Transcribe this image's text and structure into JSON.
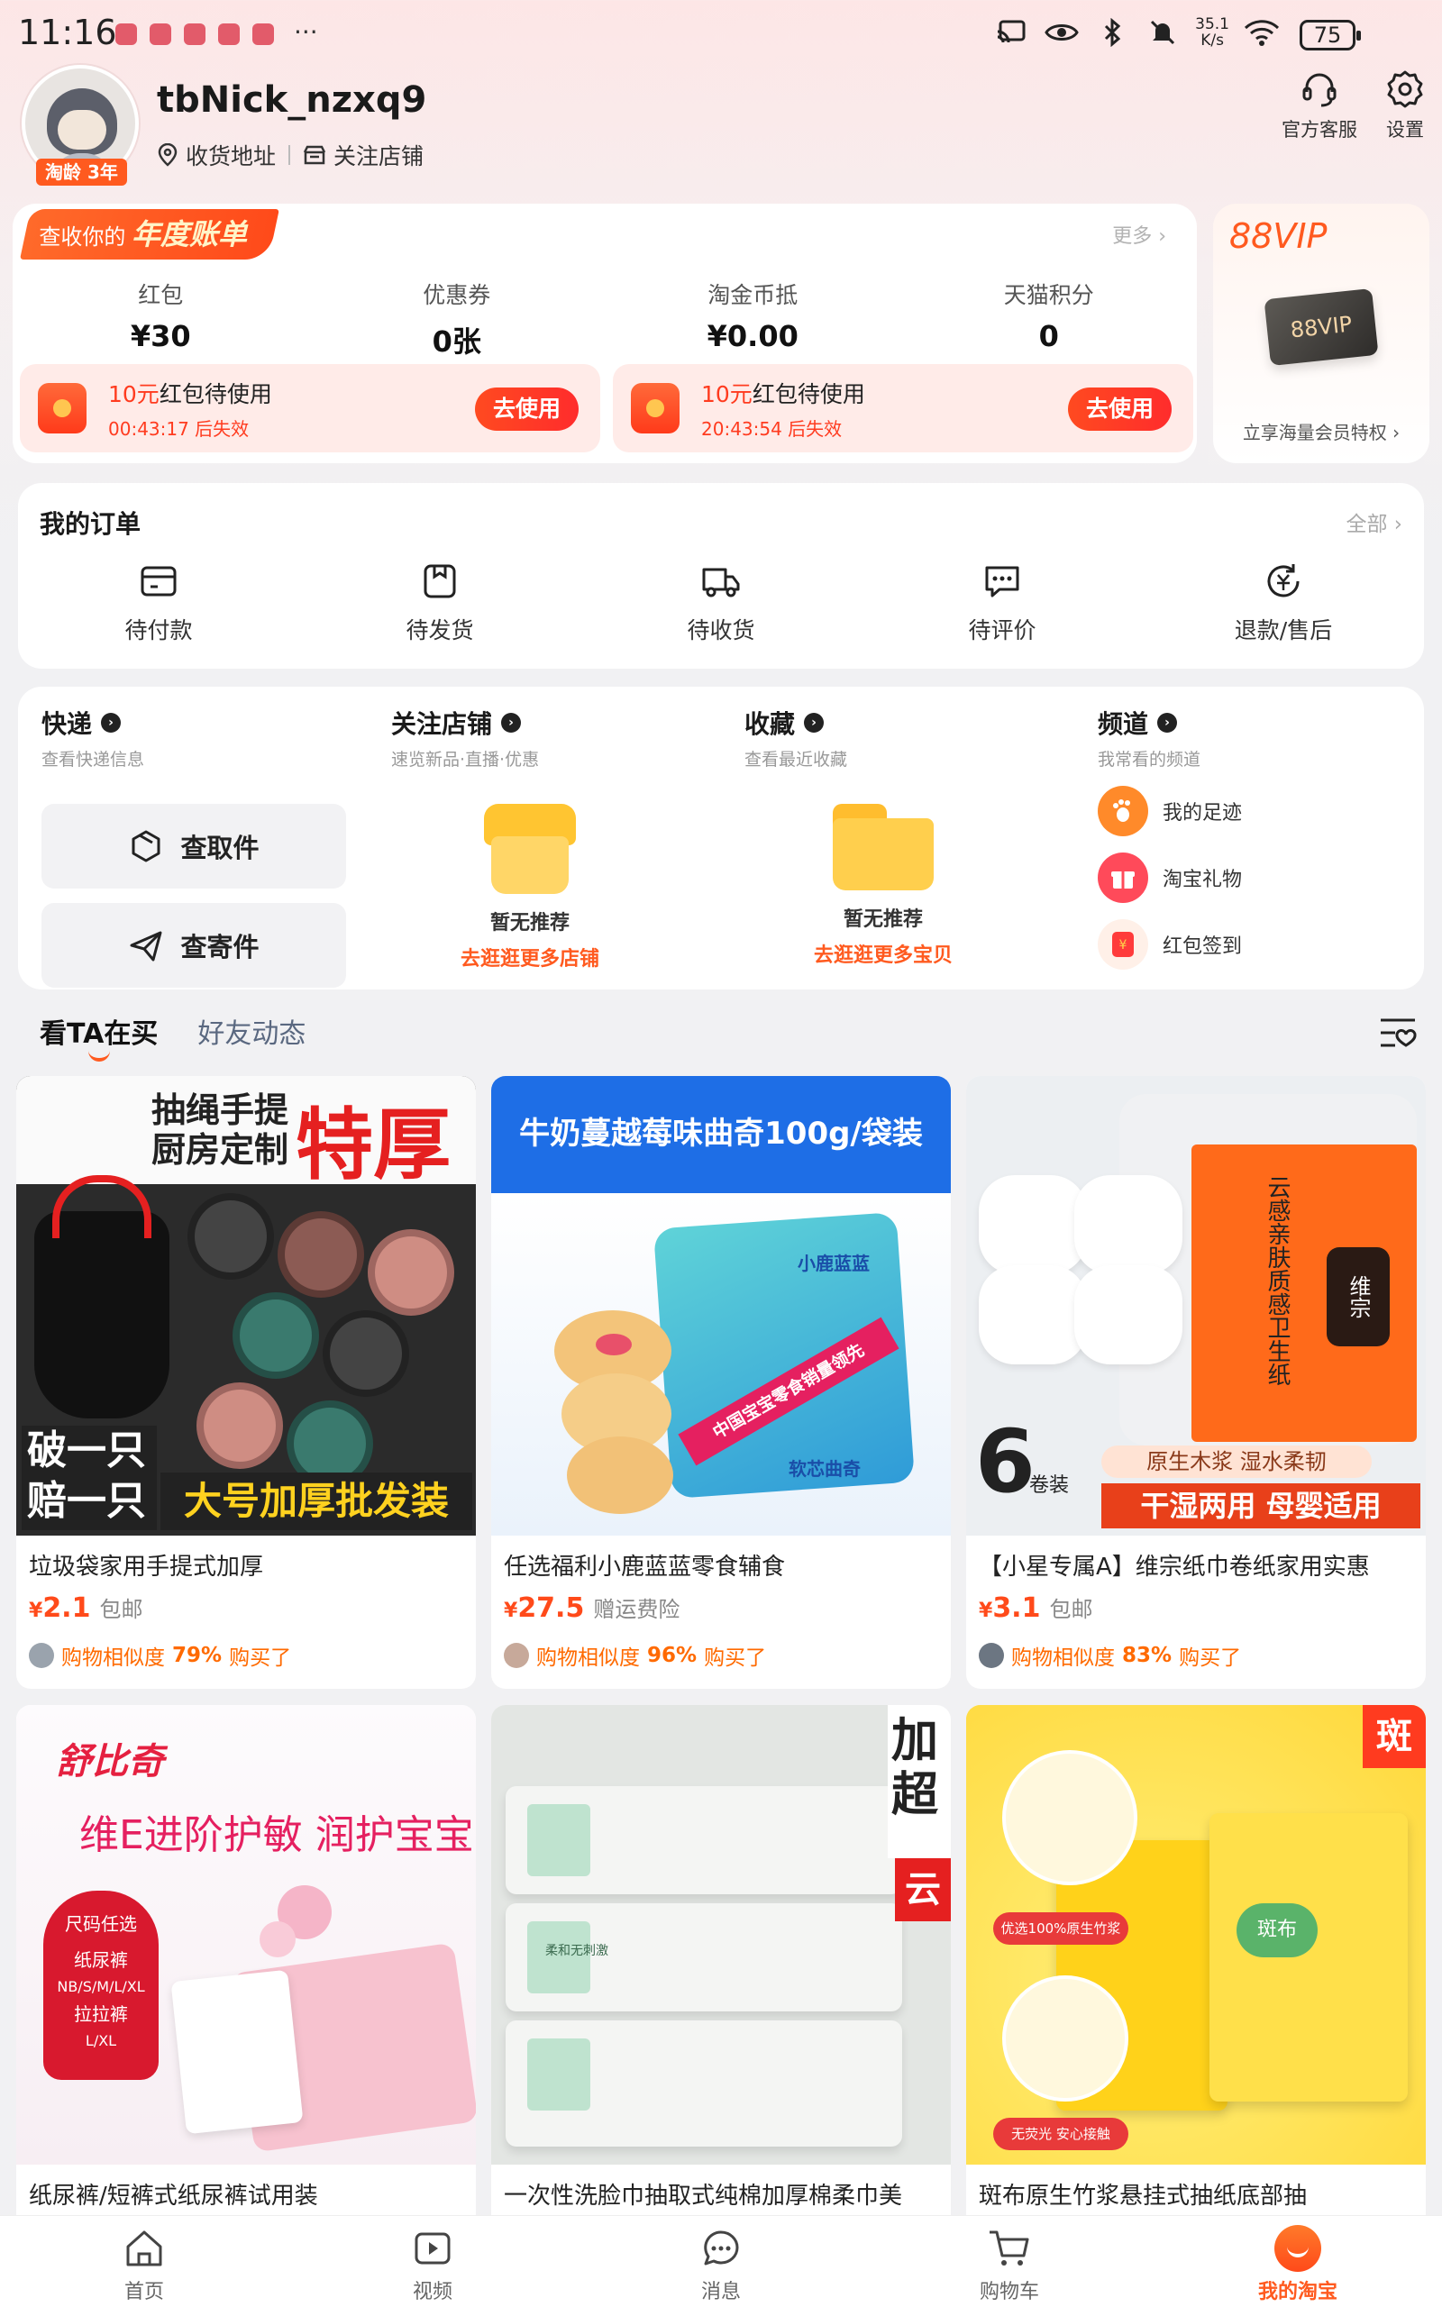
{
  "status_bar": {
    "time": "11:16",
    "more": "···",
    "net_speed": "35.1",
    "net_unit": "K/s",
    "battery": "75"
  },
  "profile": {
    "username": "tbNick_nzxq9",
    "age_badge": "淘龄 3年",
    "address_link": "收货地址",
    "followed_stores_link": "关注店铺",
    "service_label": "官方客服",
    "settings_label": "设置"
  },
  "assets": {
    "bill_prefix": "查收你的",
    "bill_title": "年度账单",
    "more": "更多 ›",
    "items": [
      {
        "label": "红包",
        "value": "¥30"
      },
      {
        "label": "优惠券",
        "value": "0张"
      },
      {
        "label": "淘金币抵",
        "value": "¥0.00"
      },
      {
        "label": "天猫积分",
        "value": "0"
      }
    ],
    "coupons": [
      {
        "amount": "10元",
        "text": "红包待使用",
        "countdown": "00:43:17 后失效",
        "button": "去使用"
      },
      {
        "amount": "10元",
        "text": "红包待使用",
        "countdown": "20:43:54 后失效",
        "button": "去使用"
      }
    ]
  },
  "vip": {
    "title": "88VIP",
    "card": "88VIP",
    "subtitle": "立享海量会员特权 ›"
  },
  "orders": {
    "title": "我的订单",
    "all": "全部 ›",
    "items": [
      "待付款",
      "待发货",
      "待收货",
      "待评价",
      "退款/售后"
    ]
  },
  "quick": {
    "express": {
      "title": "快递",
      "subtitle": "查看快递信息",
      "pickup": "查取件",
      "send": "查寄件"
    },
    "followed": {
      "title": "关注店铺",
      "subtitle": "速览新品·直播·优惠",
      "empty": "暂无推荐",
      "cta": "去逛逛更多店铺"
    },
    "favorites": {
      "title": "收藏",
      "subtitle": "查看最近收藏",
      "empty": "暂无推荐",
      "cta": "去逛逛更多宝贝"
    },
    "channels": {
      "title": "频道",
      "subtitle": "我常看的频道",
      "items": [
        "我的足迹",
        "淘宝礼物",
        "红包签到"
      ]
    }
  },
  "feed_tabs": [
    "看TA在买",
    "好友动态"
  ],
  "products": [
    {
      "title": "垃圾袋家用手提式加厚",
      "currency": "¥",
      "price": "2.1",
      "tag": "包邮",
      "sim_prefix": "购物相似度",
      "sim_value": "79%",
      "sim_suffix": "购买了",
      "img_text": {
        "t1": "抽绳手提",
        "t2": "厨房定制",
        "t3": "特厚",
        "t4": "破一只",
        "t5": "赔一只",
        "t6": "大号加厚批发装"
      }
    },
    {
      "title": "任选福利小鹿蓝蓝零食辅食",
      "currency": "¥",
      "price": "27.5",
      "tag": "赠运费险",
      "sim_prefix": "购物相似度",
      "sim_value": "96%",
      "sim_suffix": "购买了",
      "img_text": {
        "banner": "牛奶蔓越莓味曲奇100g/袋装",
        "brand": "小鹿蓝蓝",
        "slogan": "中国宝宝零食销量领先",
        "name": "软芯曲奇"
      }
    },
    {
      "title": "【小星专属A】维宗纸巾卷纸家用实惠",
      "currency": "¥",
      "price": "3.1",
      "tag": "包邮",
      "sim_prefix": "购物相似度",
      "sim_value": "83%",
      "sim_suffix": "购买了",
      "img_text": {
        "pack": "云感亲肤质感卫生纸",
        "brand": "维宗",
        "count": "6",
        "unit": "卷装",
        "line1": "原生木浆 湿水柔韧",
        "line2": "干湿两用 母婴适用"
      }
    },
    {
      "title": "纸尿裤/短裤式纸尿裤试用装",
      "img_text": {
        "brand": "舒比奇",
        "headline": "维E进阶护敏 润护宝宝",
        "box1": "尺码任选",
        "box2": "纸尿裤",
        "box3": "NB/S/M/L/XL",
        "box4": "拉拉裤",
        "box5": "L/XL"
      }
    },
    {
      "title": "一次性洗脸巾抽取式纯棉加厚棉柔巾美",
      "img_text": {
        "side1": "加",
        "side2": "超",
        "side3": "云",
        "pack": "柔和无刺激"
      }
    },
    {
      "title": "斑布原生竹浆悬挂式抽纸底部抽",
      "img_text": {
        "corner": "斑",
        "brand": "斑布",
        "tag1": "优选100%原生竹浆",
        "tag2": "无荧光 安心接触"
      }
    }
  ],
  "bottom_nav": [
    "首页",
    "视频",
    "消息",
    "购物车",
    "我的淘宝"
  ],
  "colors": {
    "accent": "#ff5a1f",
    "price": "#ff4a1a",
    "coupon_bg": "#ffebe8"
  }
}
